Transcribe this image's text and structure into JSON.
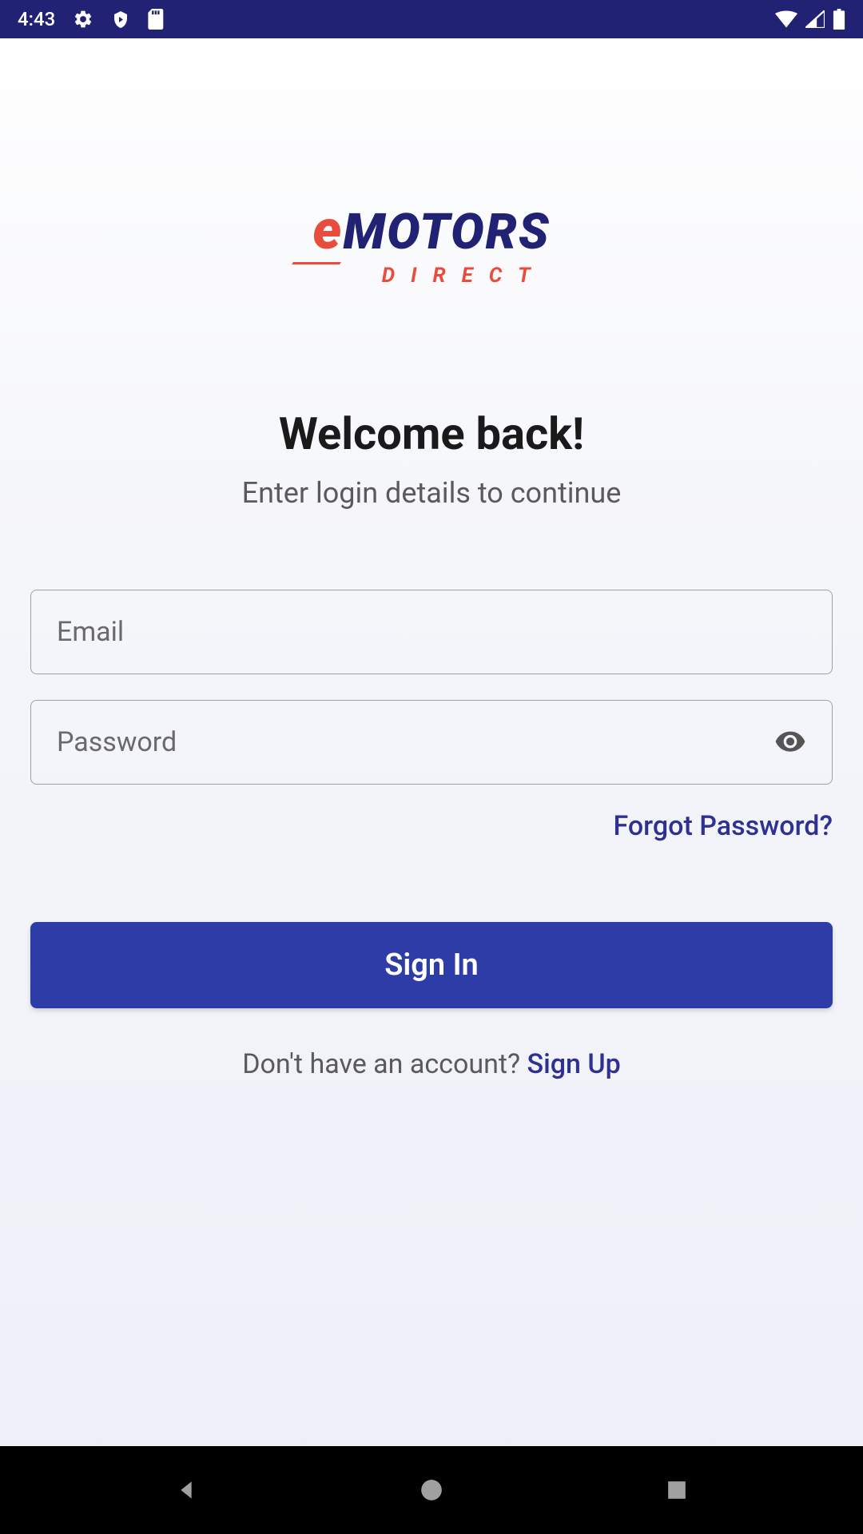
{
  "status_bar": {
    "time": "4:43"
  },
  "logo": {
    "prefix": "e",
    "main": "MOTORS",
    "sub": "DIRECT"
  },
  "welcome": {
    "title": "Welcome back!",
    "subtitle": "Enter login details to continue"
  },
  "form": {
    "email_placeholder": "Email",
    "password_placeholder": "Password",
    "forgot_password": "Forgot Password?",
    "signin_button": "Sign In"
  },
  "signup": {
    "prompt": "Don't have an account? ",
    "link": "Sign Up"
  },
  "colors": {
    "primary_dark": "#222275",
    "primary_blue": "#2E3CA8",
    "accent_red": "#E84C3D",
    "link_blue": "#2E3192"
  }
}
